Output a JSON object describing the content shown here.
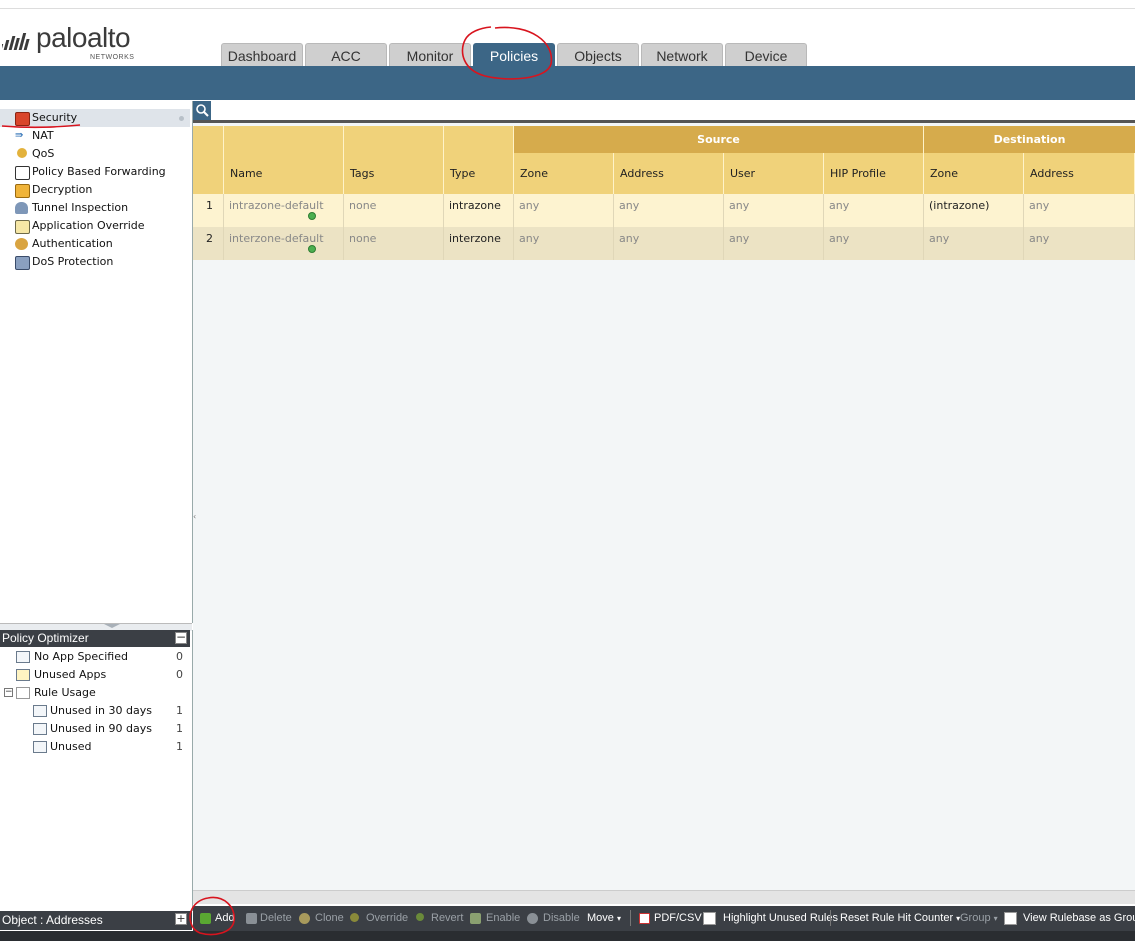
{
  "brand": {
    "name": "paloalto",
    "sub": "NETWORKS"
  },
  "tabs": [
    {
      "label": "Dashboard",
      "active": false
    },
    {
      "label": "ACC",
      "active": false
    },
    {
      "label": "Monitor",
      "active": false
    },
    {
      "label": "Policies",
      "active": true
    },
    {
      "label": "Objects",
      "active": false
    },
    {
      "label": "Network",
      "active": false
    },
    {
      "label": "Device",
      "active": false
    }
  ],
  "sidebar": {
    "items": [
      {
        "label": "Security",
        "selected": true,
        "icon": "security-icon"
      },
      {
        "label": "NAT",
        "selected": false,
        "icon": "nat-icon"
      },
      {
        "label": "QoS",
        "selected": false,
        "icon": "qos-icon"
      },
      {
        "label": "Policy Based Forwarding",
        "selected": false,
        "icon": "pbf-icon"
      },
      {
        "label": "Decryption",
        "selected": false,
        "icon": "lock-icon"
      },
      {
        "label": "Tunnel Inspection",
        "selected": false,
        "icon": "tunnel-icon"
      },
      {
        "label": "Application Override",
        "selected": false,
        "icon": "app-override-icon"
      },
      {
        "label": "Authentication",
        "selected": false,
        "icon": "users-icon"
      },
      {
        "label": "DoS Protection",
        "selected": false,
        "icon": "shield-icon"
      }
    ]
  },
  "optimizer": {
    "title": "Policy Optimizer",
    "items": [
      {
        "label": "No App Specified",
        "count": "0"
      },
      {
        "label": "Unused Apps",
        "count": "0"
      },
      {
        "label": "Rule Usage",
        "count": ""
      },
      {
        "label": "Unused in 30 days",
        "count": "1"
      },
      {
        "label": "Unused in 90 days",
        "count": "1"
      },
      {
        "label": "Unused",
        "count": "1"
      }
    ]
  },
  "object_bar": {
    "label": "Object : Addresses"
  },
  "table": {
    "groups": {
      "source": "Source",
      "destination": "Destination"
    },
    "columns": [
      "Name",
      "Tags",
      "Type",
      "Zone",
      "Address",
      "User",
      "HIP Profile",
      "Zone",
      "Address"
    ],
    "rows": [
      {
        "num": "1",
        "name": "intrazone-default",
        "tags": "none",
        "type": "intrazone",
        "src_zone": "any",
        "src_address": "any",
        "user": "any",
        "hip": "any",
        "dst_zone": "(intrazone)",
        "dst_address": "any"
      },
      {
        "num": "2",
        "name": "interzone-default",
        "tags": "none",
        "type": "interzone",
        "src_zone": "any",
        "src_address": "any",
        "user": "any",
        "hip": "any",
        "dst_zone": "any",
        "dst_address": "any"
      }
    ]
  },
  "toolbar": {
    "add": "Add",
    "delete": "Delete",
    "clone": "Clone",
    "override": "Override",
    "revert": "Revert",
    "enable": "Enable",
    "disable": "Disable",
    "move": "Move",
    "pdf_csv": "PDF/CSV",
    "highlight_unused": "Highlight Unused Rules",
    "reset_counter": "Reset Rule Hit Counter",
    "group": "Group",
    "view_groups": "View Rulebase as Groups"
  },
  "colors": {
    "header_blue": "#3c6686",
    "group_gold": "#d6ab4c",
    "column_gold": "#f0d27a",
    "row1": "#fdf3d0",
    "row2": "#ece3c4",
    "annotation_red": "#d8141e"
  }
}
